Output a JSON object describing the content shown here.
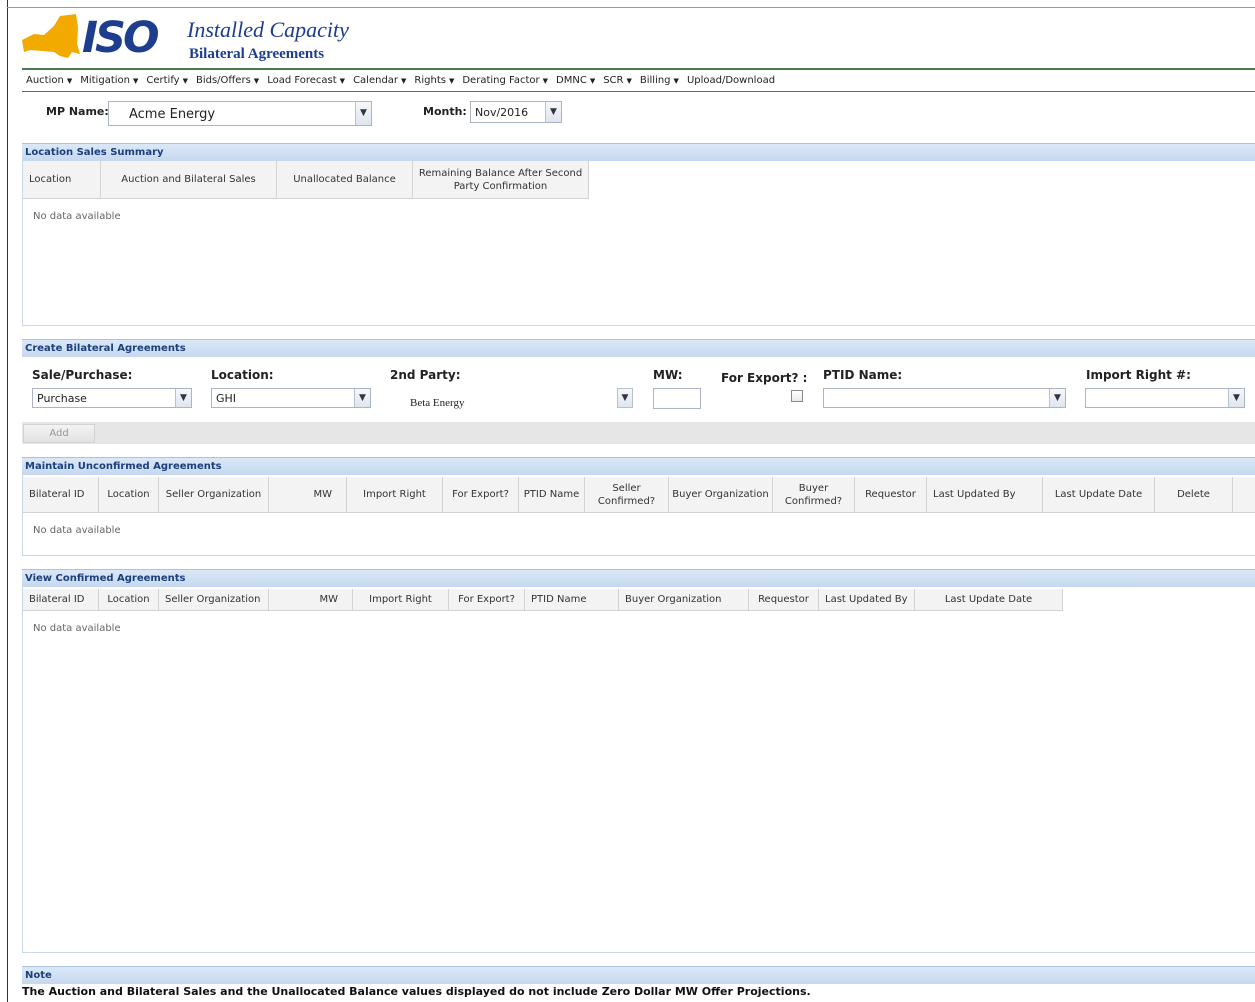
{
  "header": {
    "logo_text": "ISO",
    "app_title": "Installed Capacity",
    "app_subtitle": "Bilateral Agreements"
  },
  "menu": [
    {
      "label": "Auction",
      "caret": true
    },
    {
      "label": "Mitigation",
      "caret": true
    },
    {
      "label": "Certify",
      "caret": true
    },
    {
      "label": "Bids/Offers",
      "caret": true
    },
    {
      "label": "Load Forecast",
      "caret": true
    },
    {
      "label": "Calendar",
      "caret": true
    },
    {
      "label": "Rights",
      "caret": true
    },
    {
      "label": "Derating Factor",
      "caret": true
    },
    {
      "label": "DMNC",
      "caret": true
    },
    {
      "label": "SCR",
      "caret": true
    },
    {
      "label": "Billing",
      "caret": true
    },
    {
      "label": "Upload/Download",
      "caret": false
    }
  ],
  "filters": {
    "mp_name_label": "MP Name:",
    "mp_name_value": "Acme Energy",
    "month_label": "Month:",
    "month_value": "Nov/2016"
  },
  "location_sales_summary": {
    "title": "Location Sales Summary",
    "columns": [
      "Location",
      "Auction and Bilateral Sales",
      "Unallocated Balance",
      "Remaining Balance After Second Party Confirmation"
    ],
    "empty_text": "No data available"
  },
  "create": {
    "title": "Create Bilateral Agreements",
    "sale_purchase_label": "Sale/Purchase:",
    "sale_purchase_value": "Purchase",
    "location_label": "Location:",
    "location_value": "GHI",
    "second_party_label": "2nd Party:",
    "second_party_value": "Beta Energy",
    "mw_label": "MW:",
    "for_export_label": "For Export? :",
    "ptid_name_label": "PTID Name:",
    "import_right_label": "Import Right #:",
    "add_button": "Add"
  },
  "unconfirmed": {
    "title": "Maintain Unconfirmed Agreements",
    "columns": [
      "Bilateral ID",
      "Location",
      "Seller Organization",
      "MW",
      "Import Right",
      "For Export?",
      "PTID Name",
      "Seller Confirmed?",
      "Buyer Organization",
      "Buyer Confirmed?",
      "Requestor",
      "Last Updated By",
      "Last Update Date",
      "Delete"
    ],
    "empty_text": "No data available"
  },
  "confirmed": {
    "title": "View Confirmed Agreements",
    "columns": [
      "Bilateral ID",
      "Location",
      "Seller Organization",
      "MW",
      "Import Right",
      "For Export?",
      "PTID Name",
      "Buyer Organization",
      "Requestor",
      "Last Updated By",
      "Last Update Date"
    ],
    "empty_text": "No data available"
  },
  "note": {
    "title": "Note",
    "text": "The Auction and Bilateral Sales and the Unallocated Balance values displayed do not include Zero Dollar MW Offer Projections."
  },
  "icons": {
    "dropdown": "chevron-down-icon",
    "menu_caret": "caret-down-icon",
    "logo_map": "new-york-state-map-icon"
  },
  "colors": {
    "brand_blue": "#1d3d8f",
    "logo_orange": "#f2a900",
    "menu_rule_green": "#4b7a52",
    "section_header": "#c6d8ef"
  }
}
